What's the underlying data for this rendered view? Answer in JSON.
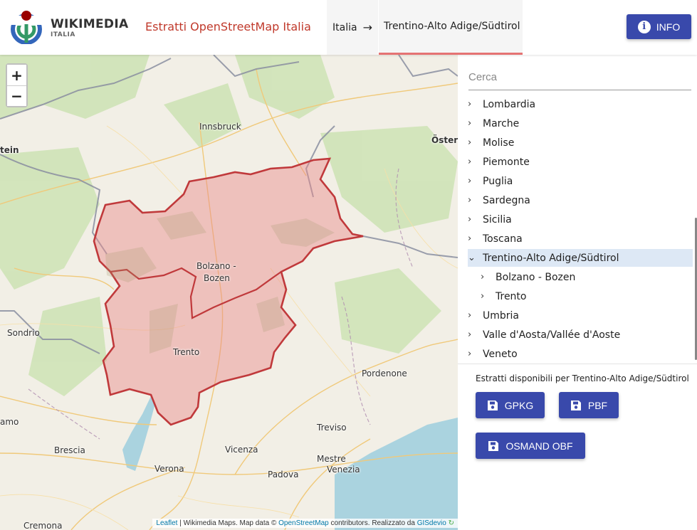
{
  "header": {
    "logo_word": "WIKIMEDIA",
    "logo_sub": "ITALIA",
    "site_title": "Estratti OpenStreetMap Italia",
    "breadcrumb": [
      {
        "label": "Italia"
      },
      {
        "label": "Trentino-Alto Adige/Südtirol"
      }
    ],
    "breadcrumb_arrow": "→",
    "info_label": "INFO"
  },
  "map": {
    "zoom_in": "+",
    "zoom_out": "−",
    "labels": {
      "innsbruck": "Innsbruck",
      "ostern": "Öster",
      "tein": "tein",
      "bolzano_1": "Bolzano -",
      "bolzano_2": "Bozen",
      "trento": "Trento",
      "sondrio": "Sondrio",
      "pordenone": "Pordenone",
      "amo": "amo",
      "treviso": "Treviso",
      "brescia": "Brescia",
      "vicenza": "Vicenza",
      "mestre": "Mestre",
      "venezia": "Venezia",
      "verona": "Verona",
      "padova": "Padova",
      "cremona": "Cremona"
    },
    "attribution": {
      "leaflet": "Leaflet",
      "part1": " | Wikimedia Maps. Map data © ",
      "osm": "OpenStreetMap",
      "part2": " contributors. Realizzato da ",
      "gisdevio": "GISdevio"
    },
    "colors": {
      "region_fill": "#e88a8a",
      "region_border": "#c0393b"
    }
  },
  "sidebar": {
    "search_placeholder": "Cerca",
    "items": [
      {
        "label": "Lombardia",
        "chevron": "›"
      },
      {
        "label": "Marche",
        "chevron": "›"
      },
      {
        "label": "Molise",
        "chevron": "›"
      },
      {
        "label": "Piemonte",
        "chevron": "›"
      },
      {
        "label": "Puglia",
        "chevron": "›"
      },
      {
        "label": "Sardegna",
        "chevron": "›"
      },
      {
        "label": "Sicilia",
        "chevron": "›"
      },
      {
        "label": "Toscana",
        "chevron": "›"
      },
      {
        "label": "Trentino-Alto Adige/Südtirol",
        "chevron": "⌄",
        "selected": true
      },
      {
        "label": "Bolzano - Bozen",
        "chevron": "›",
        "child": true
      },
      {
        "label": "Trento",
        "chevron": "›",
        "child": true
      },
      {
        "label": "Umbria",
        "chevron": "›"
      },
      {
        "label": "Valle d'Aosta/Vallée d'Aoste",
        "chevron": "›"
      },
      {
        "label": "Veneto",
        "chevron": "›"
      }
    ],
    "downloads": {
      "title": "Estratti disponibili per Trentino-Alto Adige/Südtirol",
      "gpkg": "GPKG",
      "pbf": "PBF",
      "osmand": "OSMAND OBF"
    }
  }
}
